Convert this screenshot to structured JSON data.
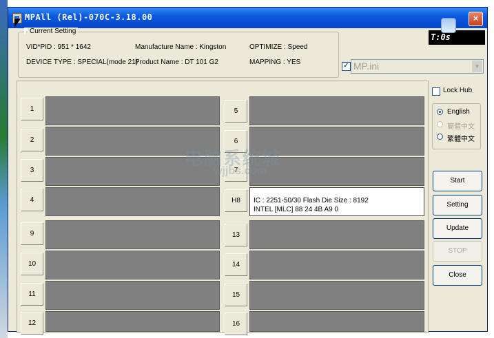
{
  "window": {
    "title": "MPAll (Rel)-070C-3.18.00",
    "close_label": "×"
  },
  "settings": {
    "group_title": "Current Setting",
    "vidpid": "VID*PID :  951 * 1642",
    "manufacture": "Manufacture Name : Kingston",
    "optimize": "OPTIMIZE : Speed",
    "device_type": "DEVICE TYPE : SPECIAL(mode 21)",
    "product": "Product Name : DT 101 G2",
    "mapping": "MAPPING : YES"
  },
  "display": {
    "text": "T:0s"
  },
  "ini": {
    "checked": "✓",
    "value": "MP.ini",
    "arrow": "▼"
  },
  "ports": {
    "left": [
      {
        "label": "1"
      },
      {
        "label": "2"
      },
      {
        "label": "3"
      },
      {
        "label": "4"
      },
      {
        "label": "9"
      },
      {
        "label": "10"
      },
      {
        "label": "11"
      },
      {
        "label": "12"
      }
    ],
    "right": [
      {
        "label": "5"
      },
      {
        "label": "6"
      },
      {
        "label": "7"
      },
      {
        "label": "H8"
      },
      {
        "label": "13"
      },
      {
        "label": "14"
      },
      {
        "label": "15"
      },
      {
        "label": "16"
      }
    ],
    "active_info": {
      "line1": "IC : 2251-50/30  Flash Die Size : 8192",
      "line2": "INTEL [MLC] 88 24 4B A9 0"
    }
  },
  "lock_hub": "Lock Hub",
  "languages": [
    {
      "label": "English",
      "selected": true,
      "enabled": true
    },
    {
      "label": "簡體中文",
      "selected": false,
      "enabled": false
    },
    {
      "label": "繁體中文",
      "selected": false,
      "enabled": true
    }
  ],
  "buttons": {
    "start": "Start",
    "setting": "Setting",
    "update": "Update",
    "stop": "STOP",
    "close": "Close"
  },
  "watermark": {
    "line1": "电脑系统城",
    "line2": "wjjbs.com"
  }
}
